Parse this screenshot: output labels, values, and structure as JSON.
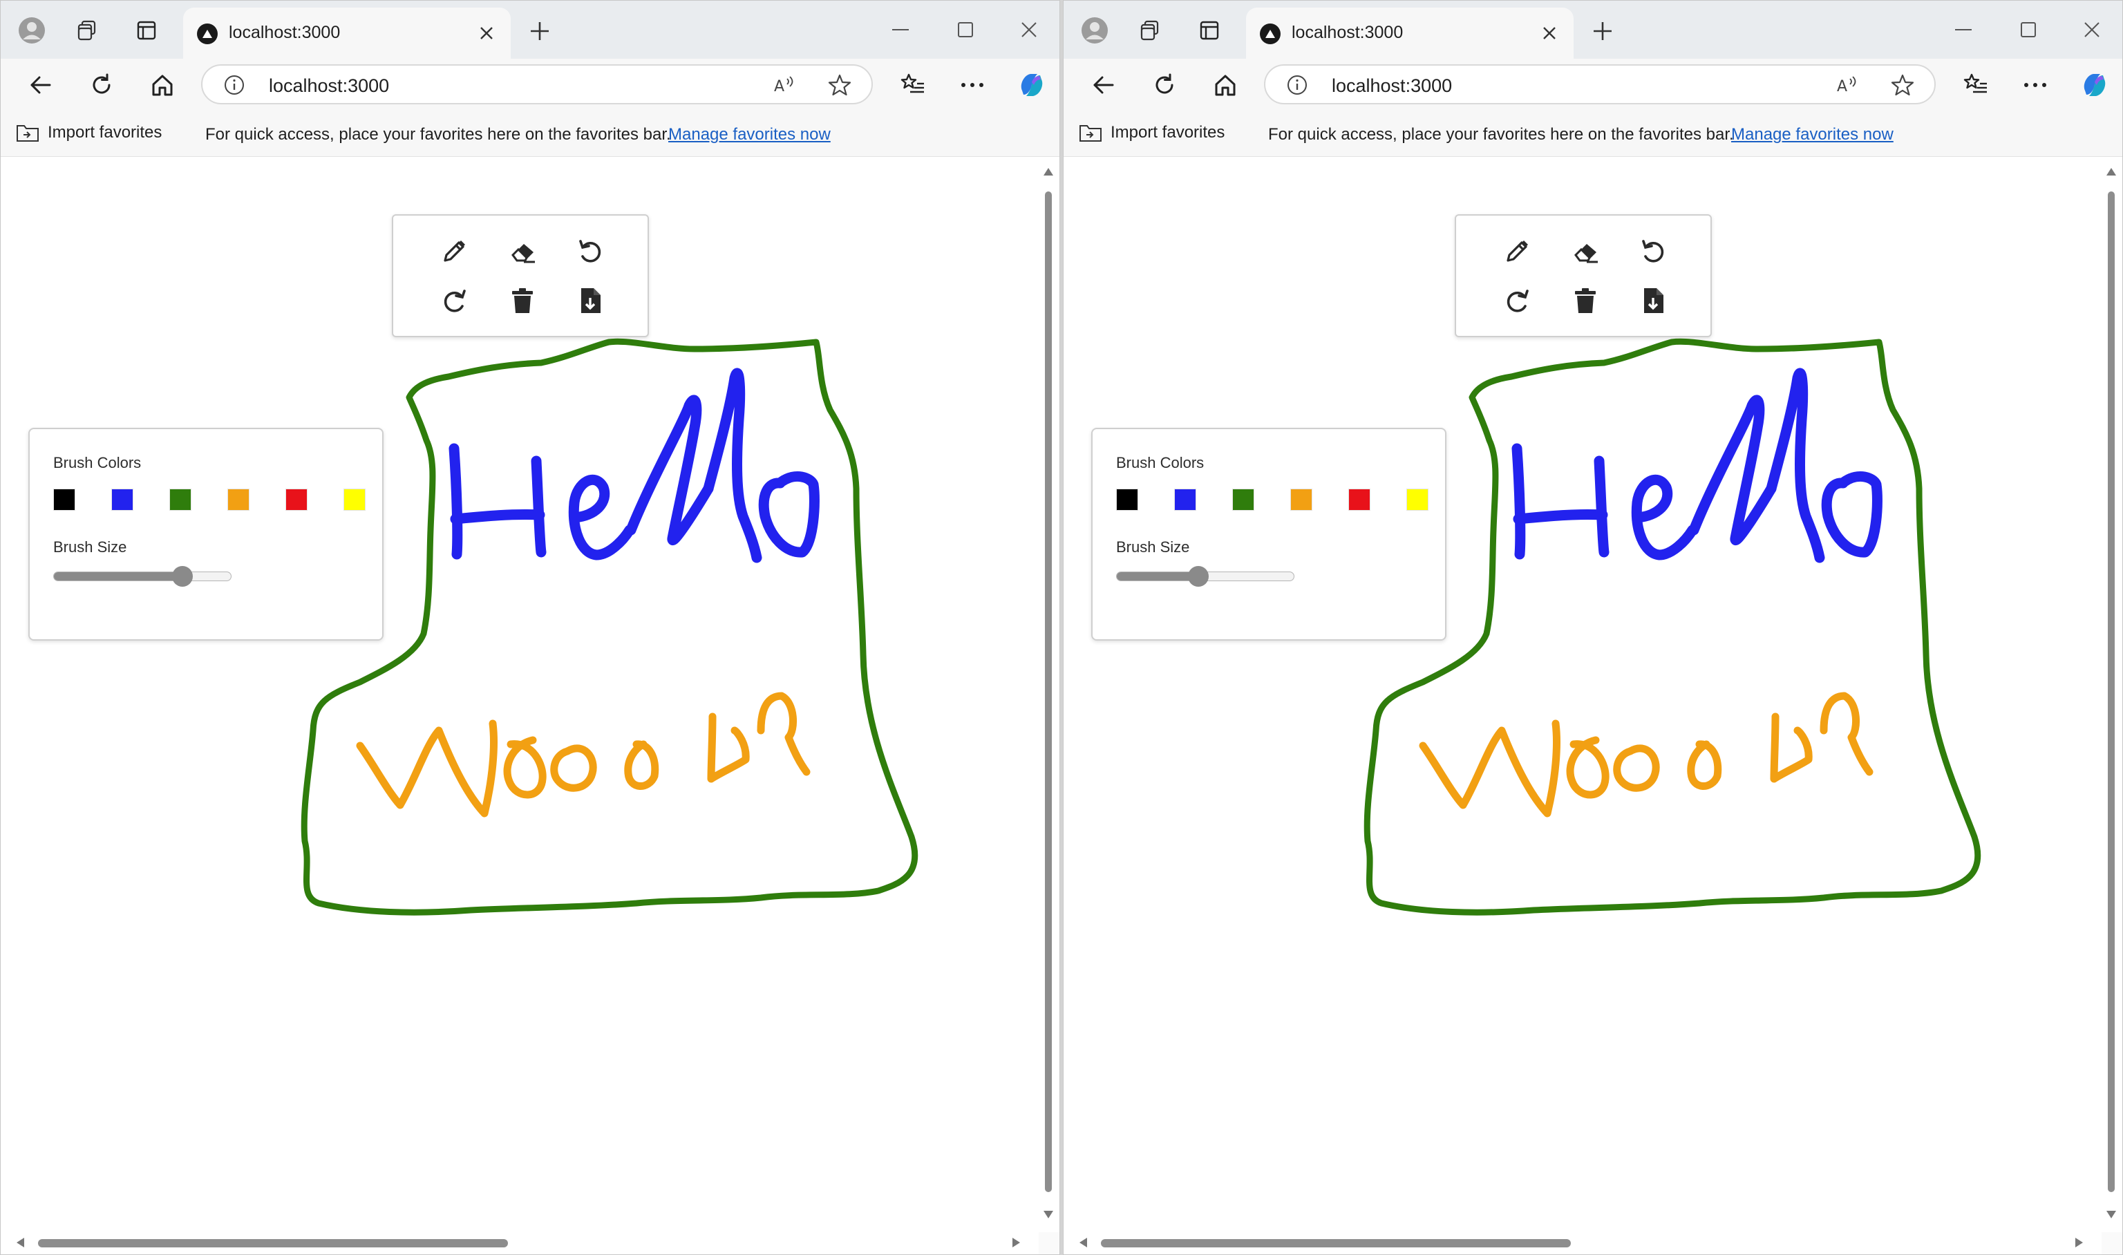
{
  "colors": {
    "accent_blue": "#1a5fc4",
    "hello_stroke": "#2222ee",
    "world_stroke": "#f2a013",
    "outline_stroke": "#2f7d0c"
  },
  "windows": [
    {
      "tab": {
        "title": "localhost:3000",
        "favicon": "triangle-logo-icon"
      },
      "address": {
        "url": "localhost:3000"
      },
      "favorites_bar": {
        "import_label": "Import favorites",
        "message": "For quick access, place your favorites here on the favorites bar.",
        "manage_link": "Manage favorites now"
      },
      "draw_toolbar": {
        "tools": [
          "pencil-icon",
          "eraser-icon",
          "undo-icon",
          "redo-icon",
          "trash-icon",
          "download-file-icon"
        ]
      },
      "brush_panel": {
        "colors_label": "Brush Colors",
        "colors": [
          "#000000",
          "#2222ee",
          "#2f7d0c",
          "#f2a013",
          "#e8121a",
          "#ffff00"
        ],
        "size_label": "Brush Size",
        "size_fraction": 0.75
      },
      "canvas_strokes": [
        {
          "color": "#2f7d0c",
          "text": "outline"
        },
        {
          "color": "#2222ee",
          "text": "Hello"
        },
        {
          "color": "#f2a013",
          "text": "World"
        }
      ]
    },
    {
      "tab": {
        "title": "localhost:3000",
        "favicon": "triangle-logo-icon"
      },
      "address": {
        "url": "localhost:3000"
      },
      "favorites_bar": {
        "import_label": "Import favorites",
        "message": "For quick access, place your favorites here on the favorites bar.",
        "manage_link": "Manage favorites now"
      },
      "draw_toolbar": {
        "tools": [
          "pencil-icon",
          "eraser-icon",
          "undo-icon",
          "redo-icon",
          "trash-icon",
          "download-file-icon"
        ]
      },
      "brush_panel": {
        "colors_label": "Brush Colors",
        "colors": [
          "#000000",
          "#2222ee",
          "#2f7d0c",
          "#f2a013",
          "#e8121a",
          "#ffff00"
        ],
        "size_label": "Brush Size",
        "size_fraction": 0.45
      },
      "canvas_strokes": [
        {
          "color": "#2f7d0c",
          "text": "outline"
        },
        {
          "color": "#2222ee",
          "text": "Hello"
        },
        {
          "color": "#f2a013",
          "text": "World"
        }
      ]
    }
  ]
}
